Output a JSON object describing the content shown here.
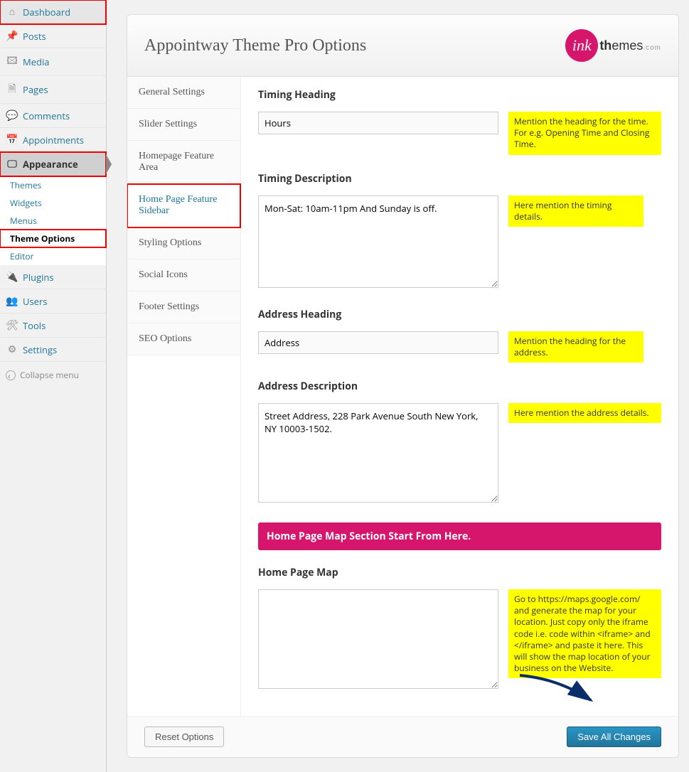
{
  "sidebar": {
    "items": [
      {
        "label": "Dashboard"
      },
      {
        "label": "Posts"
      },
      {
        "label": "Media"
      },
      {
        "label": "Pages"
      },
      {
        "label": "Comments"
      },
      {
        "label": "Appointments"
      },
      {
        "label": "Appearance"
      },
      {
        "label": "Plugins"
      },
      {
        "label": "Users"
      },
      {
        "label": "Tools"
      },
      {
        "label": "Settings"
      }
    ],
    "appearance_sub": [
      {
        "label": "Themes"
      },
      {
        "label": "Widgets"
      },
      {
        "label": "Menus"
      },
      {
        "label": "Theme Options"
      },
      {
        "label": "Editor"
      }
    ],
    "collapse": "Collapse menu"
  },
  "header": {
    "title": "Appointway Theme Pro Options",
    "logo_mark": "ink",
    "logo_text1": "th",
    "logo_text2": "emes",
    "logo_dots": ".com"
  },
  "tabs": [
    {
      "label": "General Settings"
    },
    {
      "label": "Slider Settings"
    },
    {
      "label": "Homepage Feature Area"
    },
    {
      "label": "Home Page Feature Sidebar"
    },
    {
      "label": "Styling Options"
    },
    {
      "label": "Social Icons"
    },
    {
      "label": "Footer Settings"
    },
    {
      "label": "SEO Options"
    }
  ],
  "fields": {
    "timing_heading": {
      "label": "Timing Heading",
      "value": "Hours",
      "help": "Mention the heading for the time. For e.g. Opening Time and Closing Time."
    },
    "timing_desc": {
      "label": "Timing Description",
      "value": "Mon-Sat: 10am-11pm And Sunday is off.",
      "help": "Here mention the timing details."
    },
    "address_heading": {
      "label": "Address Heading",
      "value": "Address",
      "help": "Mention the heading for the address."
    },
    "address_desc": {
      "label": "Address Description",
      "value": "Street Address, 228 Park Avenue South New York, NY 10003-1502.",
      "help": "Here mention the address details."
    },
    "map_banner": "Home Page Map Section Start From Here.",
    "home_map": {
      "label": "Home Page Map",
      "value": "",
      "help": "Go to https://maps.google.com/ and generate the map for your location. Just copy only the iframe code i.e. code within <iframe> and </iframe> and paste it here. This will show the map location of your business on the Website."
    }
  },
  "footer": {
    "reset": "Reset Options",
    "save": "Save All Changes"
  }
}
